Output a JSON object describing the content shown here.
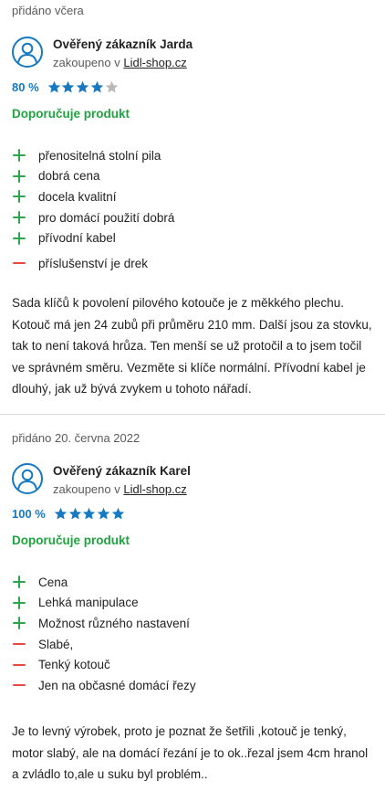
{
  "reviews": [
    {
      "date": "přidáno včera",
      "name": "Ověřený zákazník Jarda",
      "bought_prefix": "zakoupeno v",
      "shop": "Lidl-shop.cz",
      "percent": "80 %",
      "stars": 4,
      "recommend": "Doporučuje produkt",
      "pros": [
        "přenositelná stolní pila",
        "dobrá cena",
        "docela kvalitní",
        "pro domácí použití dobrá",
        "přívodní kabel"
      ],
      "cons": [
        "příslušenství je drek"
      ],
      "text": "Sada klíčů k povolení pilového kotouče je z měkkého plechu. Kotouč má jen 24 zubů při průměru 210 mm. Další jsou za stovku, tak to není taková hrůza. Ten menší se už protočil a to jsem točil ve správném směru. Vezměte si klíče normální. Přívodní kabel je dlouhý, jak už bývá zvykem u tohoto nářadí."
    },
    {
      "date": "přidáno 20. června 2022",
      "name": "Ověřený zákazník Karel",
      "bought_prefix": "zakoupeno v",
      "shop": "Lidl-shop.cz",
      "percent": "100 %",
      "stars": 5,
      "recommend": "Doporučuje produkt",
      "pros": [
        "Cena",
        "Lehká manipulace",
        "Možnost různého nastavení"
      ],
      "cons": [
        "Slabé,",
        "Tenký kotouč",
        "Jen na občasné domácí řezy"
      ],
      "text": "Je to levný výrobek, proto je poznat že šetřili ,kotouč je tenký, motor slabý, ale na domácí řezání je to ok..řezal jsem 4cm hranol a zvládlo to,ale u suku byl problém.."
    }
  ],
  "colors": {
    "accent": "#1679c2",
    "recommend": "#20a43f",
    "plus": "#2ea44f",
    "minus": "#e6493f",
    "star_empty": "#b9b9b9"
  },
  "icons": {
    "avatar": "user-avatar-icon",
    "pro": "plus-icon",
    "con": "minus-icon",
    "star": "star-icon"
  }
}
